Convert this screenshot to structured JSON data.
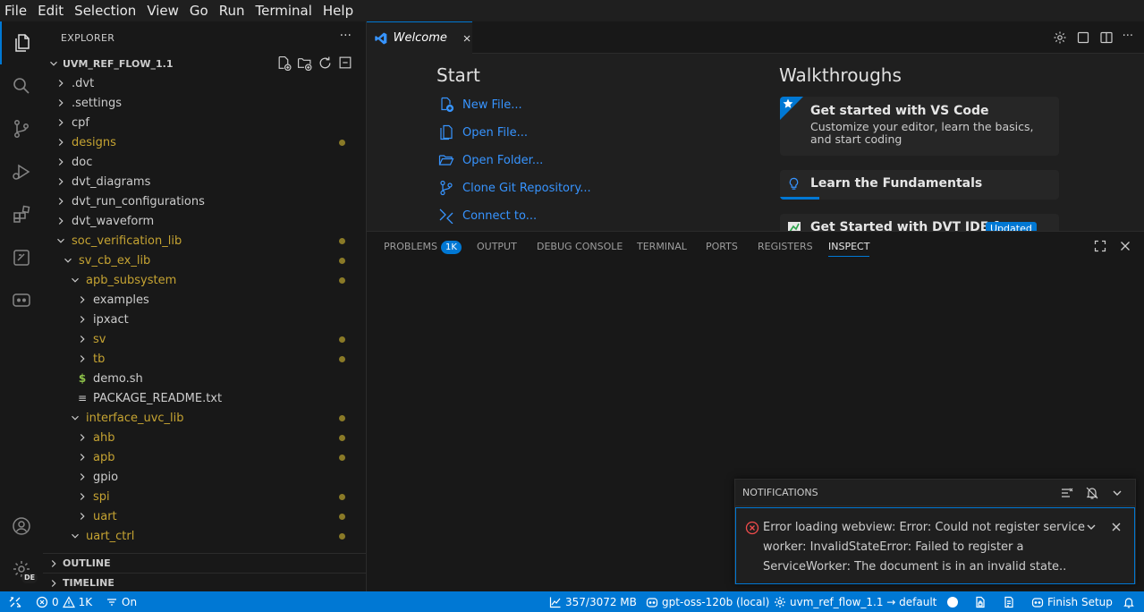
{
  "menu": [
    "File",
    "Edit",
    "Selection",
    "View",
    "Go",
    "Run",
    "Terminal",
    "Help"
  ],
  "activity_bar": {
    "items": [
      "explorer-icon",
      "search-icon",
      "source-control-icon",
      "run-debug-icon",
      "extensions-icon",
      "testing-icon",
      "chat-icon"
    ],
    "bottom": [
      "accounts-icon",
      "manage-gear-icon"
    ],
    "manage_badge": "DE"
  },
  "explorer": {
    "title": "EXPLORER",
    "more": "···",
    "root": "UVM_REF_FLOW_1.1",
    "tree": [
      {
        "label": ".dvt",
        "type": "folder",
        "depth": 0,
        "open": false,
        "mod": false
      },
      {
        "label": ".settings",
        "type": "folder",
        "depth": 0,
        "open": false,
        "mod": false
      },
      {
        "label": "cpf",
        "type": "folder",
        "depth": 0,
        "open": false,
        "mod": false
      },
      {
        "label": "designs",
        "type": "folder",
        "depth": 0,
        "open": false,
        "mod": true
      },
      {
        "label": "doc",
        "type": "folder",
        "depth": 0,
        "open": false,
        "mod": false
      },
      {
        "label": "dvt_diagrams",
        "type": "folder",
        "depth": 0,
        "open": false,
        "mod": false
      },
      {
        "label": "dvt_run_configurations",
        "type": "folder",
        "depth": 0,
        "open": false,
        "mod": false
      },
      {
        "label": "dvt_waveform",
        "type": "folder",
        "depth": 0,
        "open": false,
        "mod": false
      },
      {
        "label": "soc_verification_lib",
        "type": "folder",
        "depth": 0,
        "open": true,
        "mod": true
      },
      {
        "label": "sv_cb_ex_lib",
        "type": "folder",
        "depth": 1,
        "open": true,
        "mod": true
      },
      {
        "label": "apb_subsystem",
        "type": "folder",
        "depth": 2,
        "open": true,
        "mod": true
      },
      {
        "label": "examples",
        "type": "folder",
        "depth": 3,
        "open": false,
        "mod": false
      },
      {
        "label": "ipxact",
        "type": "folder",
        "depth": 3,
        "open": false,
        "mod": false
      },
      {
        "label": "sv",
        "type": "folder",
        "depth": 3,
        "open": false,
        "mod": true
      },
      {
        "label": "tb",
        "type": "folder",
        "depth": 3,
        "open": false,
        "mod": true
      },
      {
        "label": "demo.sh",
        "type": "shell",
        "depth": 3,
        "open": false,
        "mod": false
      },
      {
        "label": "PACKAGE_README.txt",
        "type": "text",
        "depth": 3,
        "open": false,
        "mod": false
      },
      {
        "label": "interface_uvc_lib",
        "type": "folder",
        "depth": 2,
        "open": true,
        "mod": true
      },
      {
        "label": "ahb",
        "type": "folder",
        "depth": 3,
        "open": false,
        "mod": true
      },
      {
        "label": "apb",
        "type": "folder",
        "depth": 3,
        "open": false,
        "mod": true
      },
      {
        "label": "gpio",
        "type": "folder",
        "depth": 3,
        "open": false,
        "mod": false
      },
      {
        "label": "spi",
        "type": "folder",
        "depth": 3,
        "open": false,
        "mod": true
      },
      {
        "label": "uart",
        "type": "folder",
        "depth": 3,
        "open": false,
        "mod": true
      },
      {
        "label": "uart_ctrl",
        "type": "folder",
        "depth": 2,
        "open": true,
        "mod": true
      }
    ],
    "sections": [
      "OUTLINE",
      "TIMELINE"
    ]
  },
  "editor": {
    "tab_label": "Welcome",
    "start_title": "Start",
    "start_links": [
      "New File...",
      "Open File...",
      "Open Folder...",
      "Clone Git Repository...",
      "Connect to..."
    ],
    "walkthroughs_title": "Walkthroughs",
    "walkthroughs": [
      {
        "title": "Get started with VS Code",
        "desc": "Customize your editor, learn the basics, and start coding"
      },
      {
        "title": "Learn the Fundamentals"
      },
      {
        "title": "Get Started with DVT IDE f",
        "badge": "Updated"
      }
    ],
    "fundamentals_progress": 0.14
  },
  "panel": {
    "tabs": [
      "PROBLEMS",
      "OUTPUT",
      "DEBUG CONSOLE",
      "TERMINAL",
      "PORTS",
      "REGISTERS",
      "INSPECT"
    ],
    "problems_count": "1K",
    "active_tab": "INSPECT"
  },
  "notifications": {
    "title": "NOTIFICATIONS",
    "message": "Error loading webview: Error: Could not register service worker: InvalidStateError: Failed to register a ServiceWorker: The document is in an invalid state.."
  },
  "statusbar": {
    "errors": "0",
    "warnings": "1K",
    "indent": "On",
    "memory": "357/3072 MB",
    "model": "gpt-oss-120b (local)",
    "project": "uvm_ref_flow_1.1 → default",
    "finish_setup": "Finish Setup"
  },
  "colors": {
    "accent": "#0078d4",
    "modified": "#c5a332",
    "link": "#3794ff",
    "error": "#f14c4c"
  }
}
